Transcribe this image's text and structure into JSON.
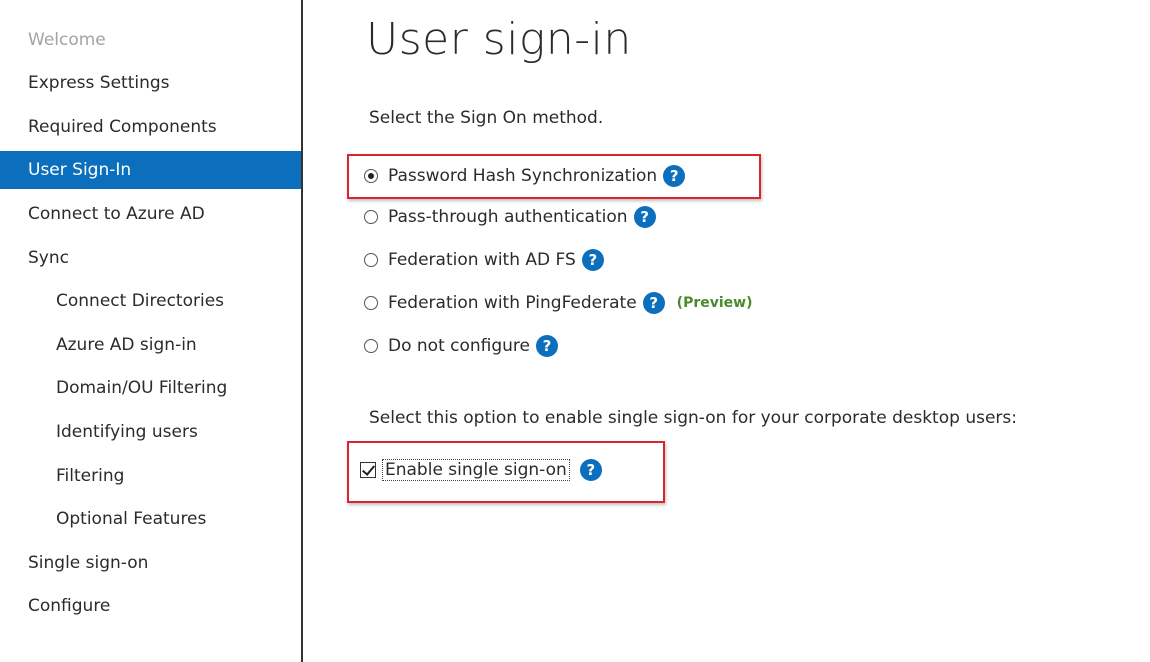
{
  "sidebar": {
    "items": [
      {
        "label": "Welcome",
        "state": "dim"
      },
      {
        "label": "Express Settings",
        "state": "normal"
      },
      {
        "label": "Required Components",
        "state": "normal"
      },
      {
        "label": "User Sign-In",
        "state": "active"
      },
      {
        "label": "Connect to Azure AD",
        "state": "normal"
      },
      {
        "label": "Sync",
        "state": "normal"
      },
      {
        "label": "Connect Directories",
        "state": "sub"
      },
      {
        "label": "Azure AD sign-in",
        "state": "sub"
      },
      {
        "label": "Domain/OU Filtering",
        "state": "sub"
      },
      {
        "label": "Identifying users",
        "state": "sub"
      },
      {
        "label": "Filtering",
        "state": "sub"
      },
      {
        "label": "Optional Features",
        "state": "sub"
      },
      {
        "label": "Single sign-on",
        "state": "normal"
      },
      {
        "label": "Configure",
        "state": "normal"
      }
    ]
  },
  "main": {
    "title": "User sign-in",
    "method_prompt": "Select the Sign On method.",
    "options": [
      {
        "label": "Password Hash Synchronization",
        "selected": true
      },
      {
        "label": "Pass-through authentication",
        "selected": false
      },
      {
        "label": "Federation with AD FS",
        "selected": false
      },
      {
        "label": "Federation with PingFederate",
        "selected": false,
        "badge": "(Preview)"
      },
      {
        "label": "Do not configure",
        "selected": false
      }
    ],
    "sso_prompt": "Select this option to enable single sign-on for your corporate desktop users:",
    "sso_checkbox": {
      "label": "Enable single sign-on",
      "checked": true
    },
    "help_glyph": "?"
  },
  "colors": {
    "accent": "#0b6fbe",
    "highlight_border": "#d9262c",
    "preview_text": "#4a8a2a"
  }
}
